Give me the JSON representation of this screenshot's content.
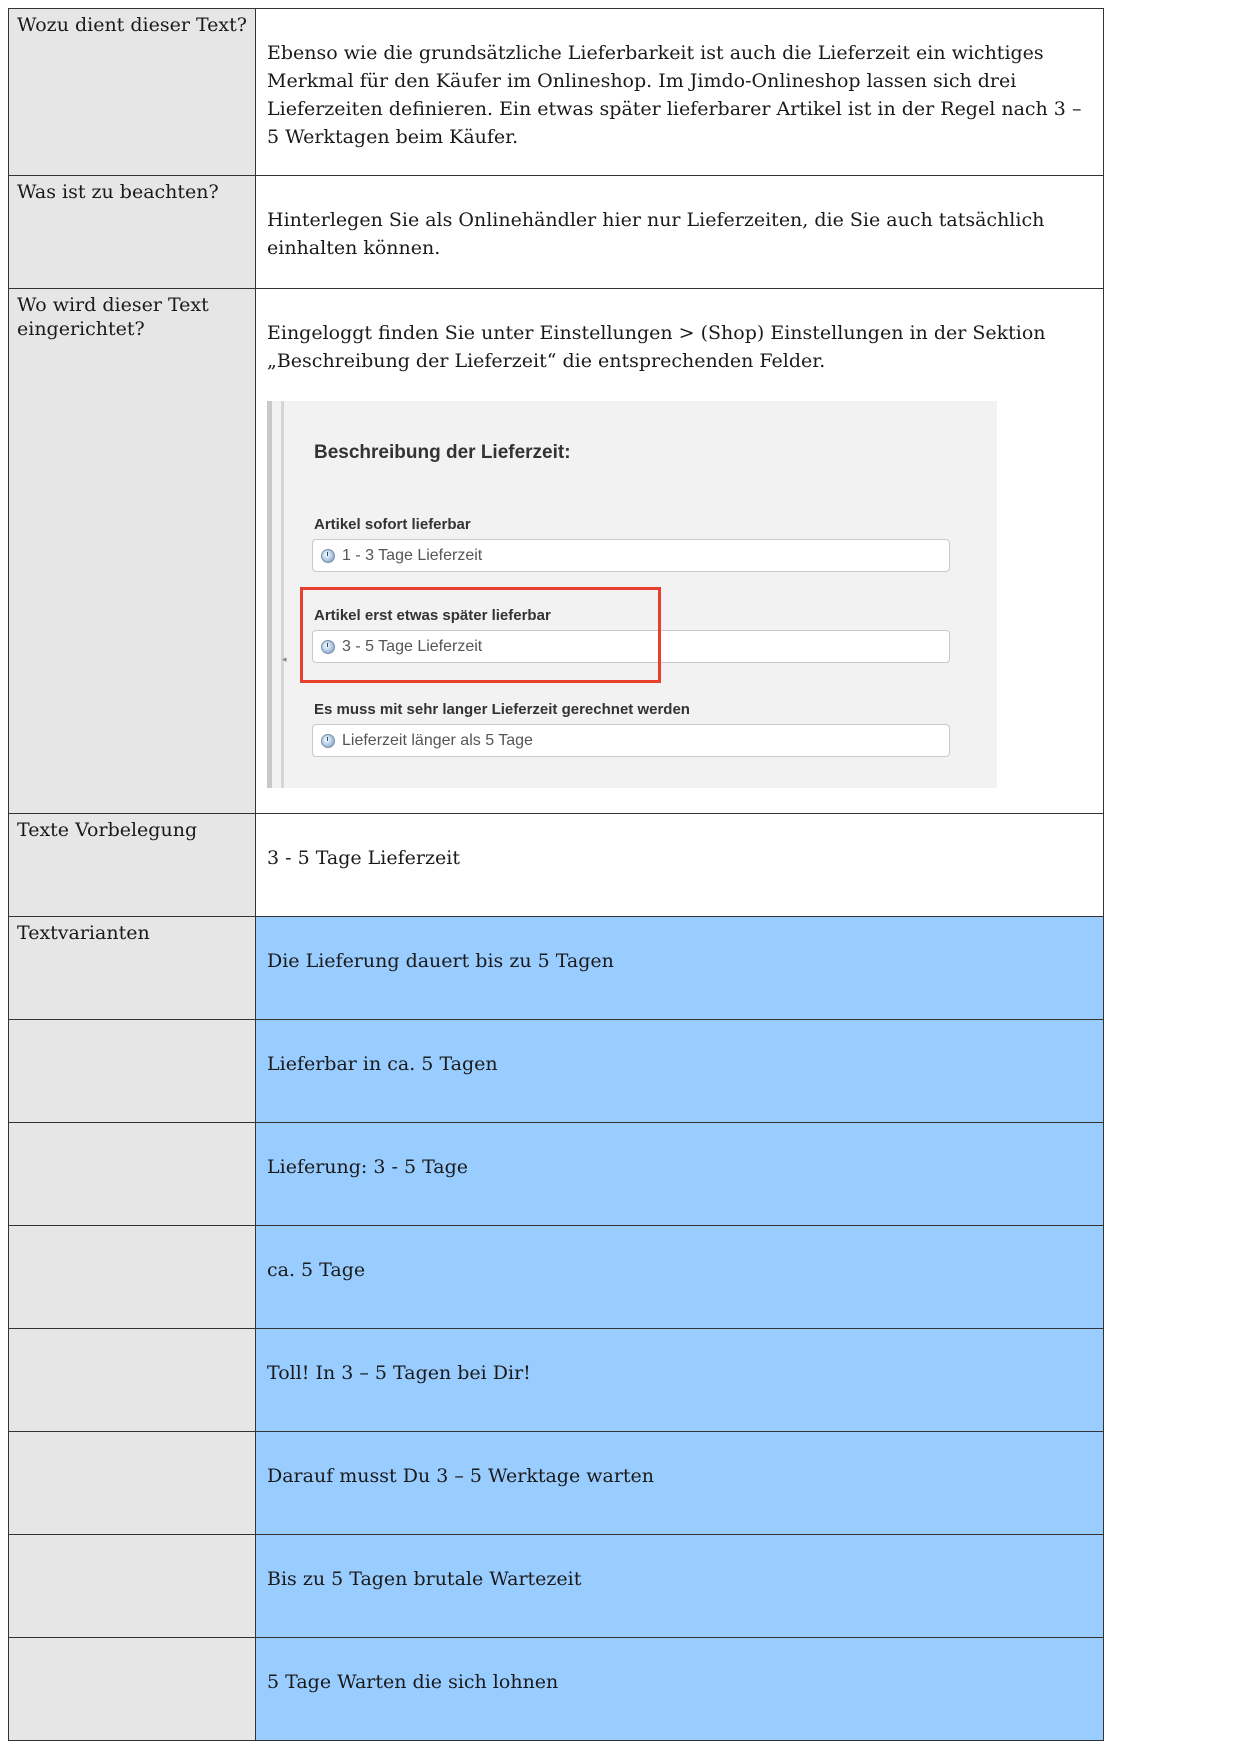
{
  "rows": [
    {
      "label": "Wozu dient dieser Text?",
      "content": "Ebenso wie die grundsätzliche Lieferbarkeit ist auch die Lieferzeit ein wichtiges Merkmal für den Käufer im Onlineshop. Im Jimdo-Onlineshop lassen sich drei Lieferzeiten definieren. Ein etwas später lieferbarer  Artikel ist in der Regel nach 3 – 5 Werktagen beim Käufer."
    },
    {
      "label": "Was ist zu beachten?",
      "content": "Hinterlegen Sie als Onlinehändler hier nur Lieferzeiten, die Sie auch tatsächlich einhalten können."
    },
    {
      "label": "Wo wird dieser Text eingerichtet?",
      "content": "Eingeloggt finden Sie unter Einstellungen > (Shop) Einstellungen in der Sektion „Beschreibung der Lieferzeit“ die entsprechenden Felder."
    },
    {
      "label": "Texte Vorbelegung",
      "content": "3 - 5 Tage Lieferzeit"
    }
  ],
  "screenshot": {
    "heading": "Beschreibung der Lieferzeit:",
    "fields": [
      {
        "label": "Artikel sofort lieferbar",
        "value": "1 - 3 Tage Lieferzeit"
      },
      {
        "label": "Artikel erst etwas später lieferbar",
        "value": "3 - 5 Tage Lieferzeit"
      },
      {
        "label": "Es muss mit sehr langer Lieferzeit gerechnet werden",
        "value": "Lieferzeit länger als 5 Tage"
      }
    ],
    "highlight_color": "#e8402f"
  },
  "variants": {
    "label": "Textvarianten",
    "items": [
      "Die Lieferung dauert bis zu 5 Tagen",
      "Lieferbar in ca. 5 Tagen",
      "Lieferung: 3 - 5 Tage",
      "ca. 5 Tage",
      "Toll! In 3 – 5 Tagen bei Dir!",
      "Darauf musst Du 3 – 5 Werktage warten",
      "Bis zu 5 Tagen brutale Wartezeit",
      "5 Tage Warten die sich lohnen"
    ],
    "row_color": "#99ccff"
  },
  "colors": {
    "label_bg": "#e6e6e6",
    "border": "#333333"
  }
}
